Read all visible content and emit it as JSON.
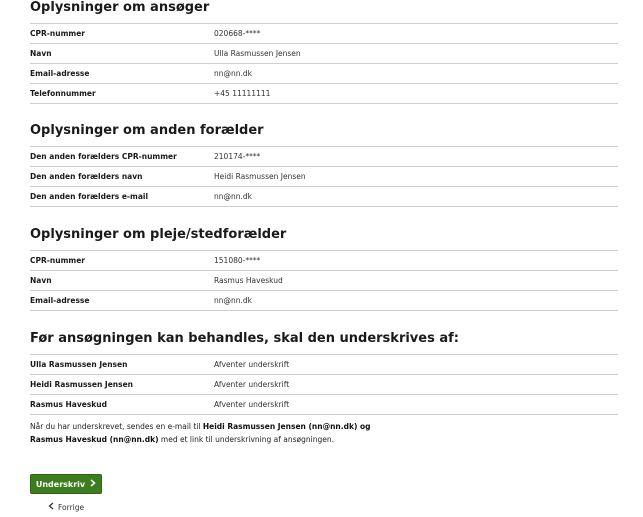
{
  "applicant": {
    "title": "Oplysninger om ansøger",
    "rows": [
      {
        "label": "CPR-nummer",
        "value": "020668-****"
      },
      {
        "label": "Navn",
        "value": "Ulla Rasmussen Jensen"
      },
      {
        "label": "Email-adresse",
        "value": "nn@nn.dk"
      },
      {
        "label": "Telefonnummer",
        "value": "+45 11111111"
      }
    ]
  },
  "other_parent": {
    "title": "Oplysninger om anden forælder",
    "rows": [
      {
        "label": "Den anden forælders CPR-nummer",
        "value": "210174-****"
      },
      {
        "label": "Den anden forælders navn",
        "value": "Heidi Rasmussen Jensen"
      },
      {
        "label": "Den anden forælders e-mail",
        "value": "nn@nn.dk"
      }
    ]
  },
  "foster_parent": {
    "title": "Oplysninger om pleje/stedforælder",
    "rows": [
      {
        "label": "CPR-nummer",
        "value": "151080-****"
      },
      {
        "label": "Navn",
        "value": "Rasmus Haveskud"
      },
      {
        "label": "Email-adresse",
        "value": "nn@nn.dk"
      }
    ]
  },
  "signatures": {
    "title": "Før ansøgningen kan behandles, skal den underskrives af:",
    "rows": [
      {
        "label": "Ulla Rasmussen Jensen",
        "value": "Afventer underskrift"
      },
      {
        "label": "Heidi Rasmussen Jensen",
        "value": "Afventer underskrift"
      },
      {
        "label": "Rasmus Haveskud",
        "value": "Afventer underskrift"
      }
    ]
  },
  "note": {
    "part1": "Når du har underskrevet, sendes en e-mail til ",
    "bold1": "Heidi Rasmussen Jensen (nn@nn.dk) og",
    "bold2": "Rasmus Haveskud (nn@nn.dk)",
    "part2": " med et link til underskrivning af ansøgningen."
  },
  "actions": {
    "sign_label": "Underskriv",
    "sign_icon": "chevron-right-icon",
    "back_label": "Forrige",
    "back_icon": "chevron-left-icon"
  }
}
